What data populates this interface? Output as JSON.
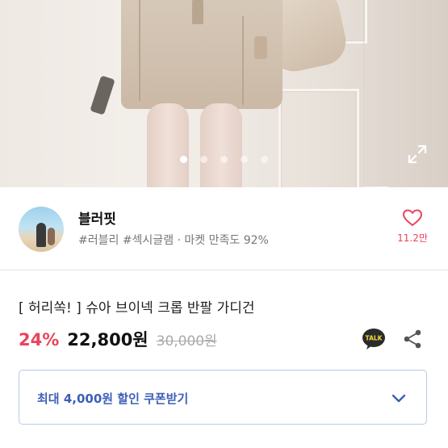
{
  "carousel": {
    "page_count": 5,
    "active_index": 0,
    "expand_icon": "expand-icon"
  },
  "seller": {
    "name": "블러핏",
    "tags": "#러블리 #섹시글램 · 마켓 만족도 92%",
    "avatar_icon": "avatar"
  },
  "like": {
    "icon": "heart-icon",
    "count": "11.2만",
    "color": "#e8445a"
  },
  "product": {
    "title": "[ 허리쏙! ] 슈아 브이넥 크롭 반팔 가디건",
    "discount": "24%",
    "price": "22,800원",
    "original_price": "30,000원",
    "talk_label": "TALK",
    "share_icon": "share-icon"
  },
  "coupon": {
    "label": "최대 4,000원 할인 쿠폰받기",
    "chevron_icon": "chevron-down-icon",
    "accent": "#3d5fb8"
  }
}
